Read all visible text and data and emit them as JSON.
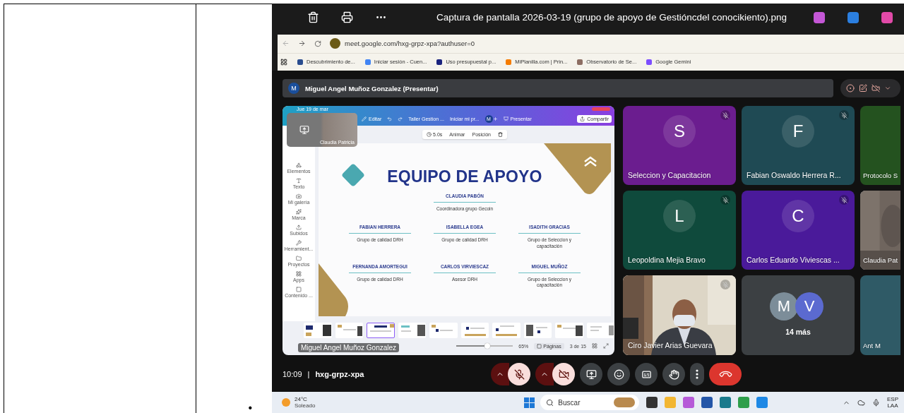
{
  "document": {
    "bullet": "•"
  },
  "viewer": {
    "title": "Captura de pantalla 2026-03-19 (grupo de apoyo de Gestióncdel conocikiento).png"
  },
  "browser": {
    "address": "meet.google.com/hxg-grpz-xpa?authuser=0",
    "bookmarks": [
      {
        "label": "Descubrimiento de..."
      },
      {
        "label": "Iniciar sesión - Cuen..."
      },
      {
        "label": "Uso presupuestal p..."
      },
      {
        "label": "MiPlanilla.com | Prin..."
      },
      {
        "label": "Observatorio de Se..."
      },
      {
        "label": "Google Gemini"
      }
    ]
  },
  "meet": {
    "presenter": {
      "initial": "M",
      "label": "Miguel Angel Muñoz Gonzalez (Presentar)"
    },
    "presentation": {
      "status": "Jue 19 de mar",
      "edit": "Editar",
      "doc_title": "Taller Gestion ...",
      "start": "Iniciar mi pr...",
      "avatar": "M",
      "present": "Presentar",
      "share": "Compartir",
      "element_bar": {
        "duration": "5.0s",
        "animate": "Animar",
        "position": "Posición"
      },
      "sidebar": [
        "Elementos",
        "Texto",
        "Mi galería",
        "Marca",
        "Subidos",
        "Herramient...",
        "Proyectos",
        "Apps",
        "Contenido ..."
      ],
      "self_view": {
        "name": "Claudia Patricia"
      },
      "slide": {
        "title": "EQUIPO DE APOYO",
        "lead": {
          "name": "CLAUDIA PABÓN",
          "role": "Coordinadora grupo Gecoin"
        },
        "members": [
          {
            "name": "FABIAN HERRERA",
            "role": "Grupo de calidad  DRH"
          },
          {
            "name": "ISABELLA EGEA",
            "role": "Grupo de calidad  DRH"
          },
          {
            "name": "ISADITH GRACIAS",
            "role": "Grupo de Seleccion y capacitación"
          },
          {
            "name": "FERNANDA AMORTEGUI",
            "role": "Grupo de calidad  DRH"
          },
          {
            "name": "CARLOS VIRVIESCAZ",
            "role": "Asesor DRH"
          },
          {
            "name": "MIGUEL MUÑOZ",
            "role": "Grupo de Seleccion y capacitación"
          }
        ]
      },
      "thumbnails": [
        {
          "selected": false
        },
        {
          "selected": false
        },
        {
          "selected": true
        },
        {
          "selected": false
        },
        {
          "selected": false
        },
        {
          "selected": false
        },
        {
          "selected": false
        },
        {
          "selected": false
        },
        {
          "selected": false
        },
        {
          "selected": false
        }
      ],
      "footer": {
        "presenter": "Miguel Angel Muñoz Gonzalez",
        "level": 0.55,
        "zoom": "65%",
        "pages": "Páginas",
        "page": "3 de 15"
      }
    },
    "tiles": [
      {
        "kind": "avatar",
        "initial": "S",
        "name": "Seleccion y Capacitacion",
        "color": "#6b1d8f",
        "muted": true,
        "speaking": false
      },
      {
        "kind": "avatar",
        "initial": "F",
        "name": "Fabian Oswaldo Herrera R...",
        "color": "#1f4a54",
        "muted": true,
        "speaking": false
      },
      {
        "kind": "avatar",
        "name": "Protocolo S",
        "color": "#24521f",
        "muted": false,
        "speaking": false
      },
      {
        "kind": "avatar",
        "initial": "L",
        "name": "Leopoldina Mejia Bravo",
        "color": "#0f4a3c",
        "muted": true,
        "speaking": false
      },
      {
        "kind": "avatar",
        "initial": "C",
        "name": "Carlos Eduardo Viviescas ...",
        "color": "#4a1a9a",
        "muted": true,
        "speaking": false
      },
      {
        "kind": "picture",
        "name": "Claudia Pat",
        "color": "#6f655e",
        "muted": false,
        "speaking": true
      },
      {
        "kind": "picture",
        "name": "Ciro Javier Arias Guevara",
        "color": "#d9d2c2",
        "muted": true,
        "speaking": false
      },
      {
        "kind": "more",
        "avatars": [
          "M",
          "V"
        ],
        "label": "14 más",
        "color": "#3c4043",
        "muted": false,
        "speaking": false
      },
      {
        "kind": "avatar",
        "name": "Ant M",
        "color": "#2f5a66",
        "muted": false,
        "speaking": false
      }
    ],
    "meeting": {
      "time": "10:09",
      "separator": "|",
      "code": "hxg-grpz-xpa"
    },
    "controls": [
      {
        "kind": "mic",
        "on": false
      },
      {
        "kind": "camera",
        "on": false
      },
      {
        "kind": "present"
      },
      {
        "kind": "emoji"
      },
      {
        "kind": "captions"
      },
      {
        "kind": "hand"
      },
      {
        "kind": "more"
      },
      {
        "kind": "leave"
      }
    ]
  },
  "taskbar": {
    "temperature": "24°C",
    "weather": "Soleado",
    "search_placeholder": "Buscar",
    "lang": "ESP",
    "region": "LAA"
  }
}
